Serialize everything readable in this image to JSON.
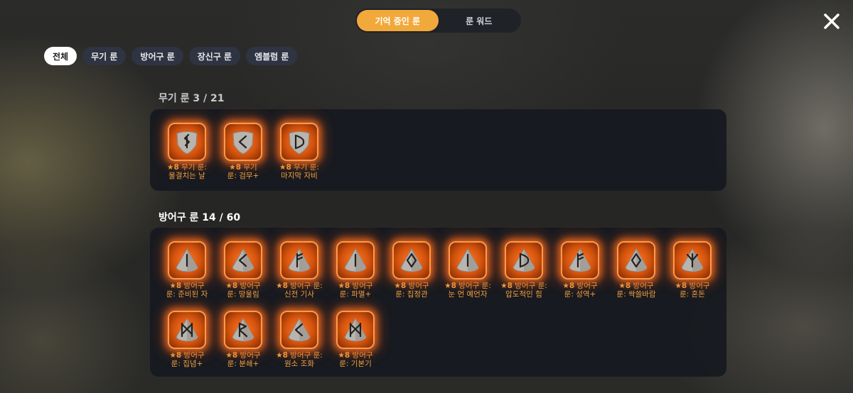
{
  "top_tabs": [
    {
      "label": "기억 중인 룬",
      "active": true
    },
    {
      "label": "룬 워드",
      "active": false
    }
  ],
  "filters": [
    {
      "label": "전체",
      "active": true
    },
    {
      "label": "무기 룬",
      "active": false
    },
    {
      "label": "방어구 룬",
      "active": false
    },
    {
      "label": "장신구 룬",
      "active": false
    },
    {
      "label": "엠블럼 룬",
      "active": false
    }
  ],
  "sections": [
    {
      "title": "무기 룬  3 / 21",
      "runes": [
        {
          "level": "8",
          "name_line1": "무기 룬:",
          "name_line2": "물결치는 날",
          "symbol": "S",
          "shape": "shield"
        },
        {
          "level": "8",
          "name_line1": "무기",
          "name_line2": "룬: 검무+",
          "symbol": "<",
          "shape": "shield"
        },
        {
          "level": "8",
          "name_line1": "무기 룬:",
          "name_line2": "마지막 자비",
          "symbol": "D",
          "shape": "shield"
        }
      ]
    },
    {
      "title": "방어구 룬  14 / 60",
      "runes": [
        {
          "level": "8",
          "name_line1": "방어구",
          "name_line2": "룬: 준비된 자",
          "symbol": "|",
          "shape": "pyramid"
        },
        {
          "level": "8",
          "name_line1": "방어구",
          "name_line2": "룬: 땅울림",
          "symbol": "<",
          "shape": "pyramid"
        },
        {
          "level": "8",
          "name_line1": "방어구 룬:",
          "name_line2": "신전 기사",
          "symbol": "F",
          "shape": "pyramid"
        },
        {
          "level": "8",
          "name_line1": "방어구",
          "name_line2": "룬: 파멸+",
          "symbol": "|",
          "shape": "pyramid"
        },
        {
          "level": "8",
          "name_line1": "방어구",
          "name_line2": "룬: 집정관",
          "symbol": "O",
          "shape": "pyramid"
        },
        {
          "level": "8",
          "name_line1": "방어구 룬:",
          "name_line2": "눈 먼 예언자",
          "symbol": "|",
          "shape": "pyramid"
        },
        {
          "level": "8",
          "name_line1": "방어구 룬:",
          "name_line2": "압도적인 힘",
          "symbol": "D",
          "shape": "pyramid"
        },
        {
          "level": "8",
          "name_line1": "방어구",
          "name_line2": "룬: 성역+",
          "symbol": "F",
          "shape": "pyramid"
        },
        {
          "level": "8",
          "name_line1": "방어구",
          "name_line2": "룬: 싹쓸바람",
          "symbol": "O",
          "shape": "pyramid"
        },
        {
          "level": "8",
          "name_line1": "방어구",
          "name_line2": "룬: 혼돈",
          "symbol": "Y",
          "shape": "pyramid"
        },
        {
          "level": "8",
          "name_line1": "방어구",
          "name_line2": "룬: 집념+",
          "symbol": "M",
          "shape": "pyramid"
        },
        {
          "level": "8",
          "name_line1": "방어구",
          "name_line2": "룬: 분쇄+",
          "symbol": "R",
          "shape": "pyramid"
        },
        {
          "level": "8",
          "name_line1": "방어구 룬:",
          "name_line2": "원소 조화",
          "symbol": "<",
          "shape": "pyramid"
        },
        {
          "level": "8",
          "name_line1": "방어구",
          "name_line2": "룬: 기본기",
          "symbol": "M",
          "shape": "pyramid"
        }
      ]
    }
  ],
  "colors": {
    "accent": "#f2a93b",
    "rune_glow": "#ff7a2a",
    "label": "#f2a244",
    "panel": "#16191f"
  }
}
